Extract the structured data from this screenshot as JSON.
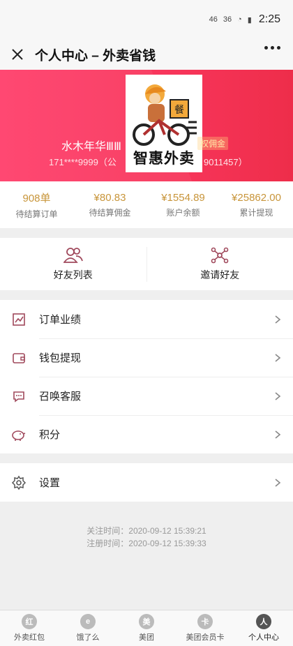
{
  "status_bar": {
    "time": "2:25",
    "left_indicators": [
      "46",
      "36"
    ]
  },
  "header": {
    "title": "个人中心 – 外卖省钱"
  },
  "profile": {
    "avatar_text": "智惠外卖",
    "name": "水木年华ⅢⅢ",
    "badge": "权佣金",
    "phone": "171****9999（公",
    "phone_suffix": "9011457）"
  },
  "stats": [
    {
      "value": "908单",
      "label": "待结算订单"
    },
    {
      "value": "¥80.83",
      "label": "待结算佣金"
    },
    {
      "value": "¥1554.89",
      "label": "账户余额"
    },
    {
      "value": "¥25862.00",
      "label": "累计提现"
    }
  ],
  "friends": [
    {
      "label": "好友列表",
      "icon": "friends-icon"
    },
    {
      "label": "邀请好友",
      "icon": "share-icon"
    }
  ],
  "menu": [
    {
      "label": "订单业绩",
      "icon": "chart-icon"
    },
    {
      "label": "钱包提现",
      "icon": "wallet-icon"
    },
    {
      "label": "召唤客服",
      "icon": "chat-icon"
    },
    {
      "label": "积分",
      "icon": "piggy-icon"
    }
  ],
  "menu2": [
    {
      "label": "设置",
      "icon": "gear-icon"
    }
  ],
  "info": {
    "follow_time": "关注时间：2020-09-12 15:39:21",
    "register_time": "注册时间：2020-09-12 15:39:33"
  },
  "tabs": [
    {
      "label": "外卖红包",
      "glyph": "红"
    },
    {
      "label": "饿了么",
      "glyph": "e"
    },
    {
      "label": "美团",
      "glyph": "美"
    },
    {
      "label": "美团会员卡",
      "glyph": "卡"
    },
    {
      "label": "个人中心",
      "glyph": "人"
    }
  ],
  "colors": {
    "accent": "#f7355a",
    "gold": "#c8953a",
    "icon": "#a0495c"
  }
}
